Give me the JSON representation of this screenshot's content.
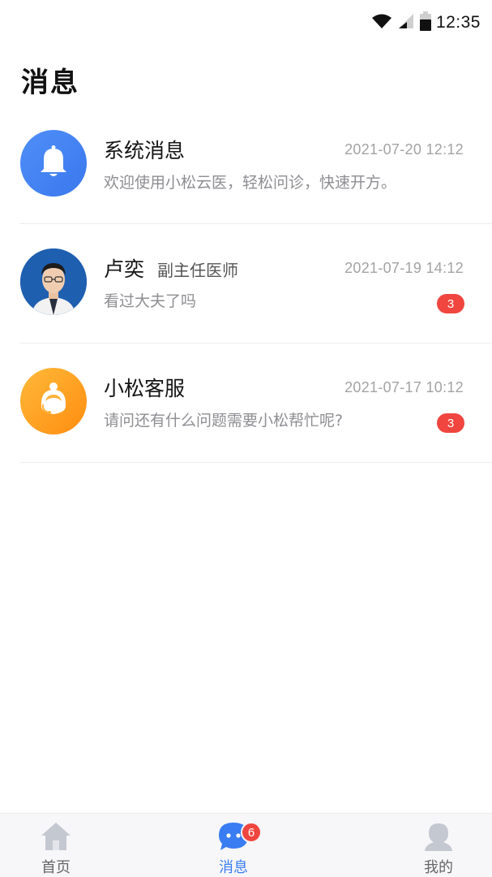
{
  "status_bar": {
    "time": "12:35",
    "icons": [
      "wifi-icon",
      "signal-icon",
      "battery-icon"
    ]
  },
  "header": {
    "title": "消息"
  },
  "messages": [
    {
      "icon": "bell-icon",
      "name": "系统消息",
      "role": "",
      "time": "2021-07-20 12:12",
      "preview": "欢迎使用小松云医，轻松问诊，快速开方。",
      "unread": null
    },
    {
      "icon": "doctor-avatar",
      "name": "卢奕",
      "role": "副主任医师",
      "time": "2021-07-19 14:12",
      "preview": "看过大夫了吗",
      "unread": "3"
    },
    {
      "icon": "customer-service-icon",
      "name": "小松客服",
      "role": "",
      "time": "2021-07-17 10:12",
      "preview": "请问还有什么问题需要小松帮忙呢?",
      "unread": "3"
    }
  ],
  "tab_bar": {
    "tabs": [
      {
        "label": "首页",
        "icon": "home-icon",
        "active": false
      },
      {
        "label": "消息",
        "icon": "chat-icon",
        "active": true,
        "badge": "6"
      },
      {
        "label": "我的",
        "icon": "profile-icon",
        "active": false
      }
    ]
  },
  "colors": {
    "accent": "#3a7df2",
    "badge": "#f0463f",
    "bell_avatar": "#4a88f4",
    "service_avatar": "#ffa424"
  }
}
